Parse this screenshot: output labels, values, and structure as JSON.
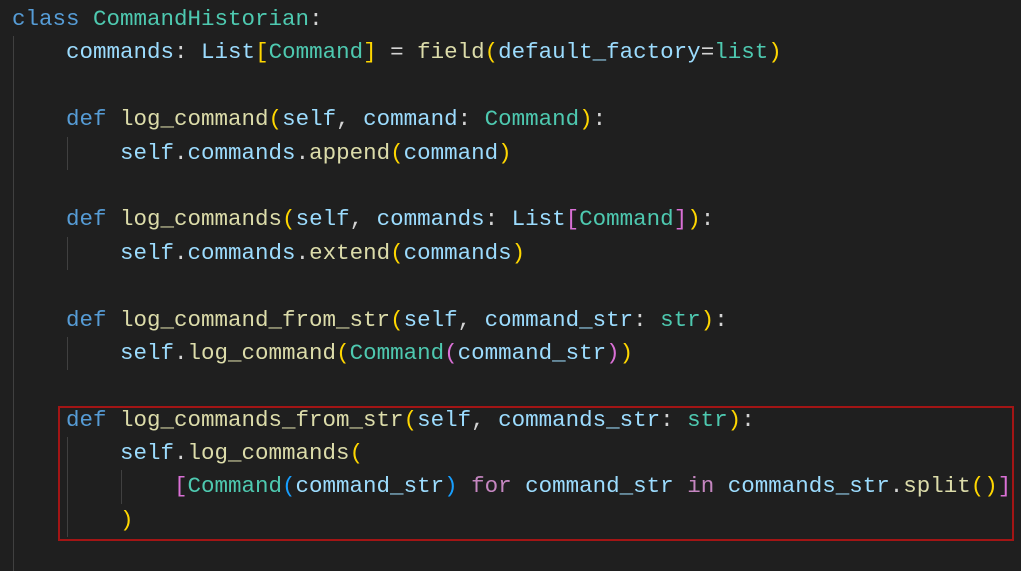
{
  "lines": [
    {
      "indent": 0,
      "tokens": [
        {
          "t": "class ",
          "c": "kw"
        },
        {
          "t": "CommandHistorian",
          "c": "cls"
        },
        {
          "t": ":",
          "c": "op"
        }
      ]
    },
    {
      "indent": 4,
      "tokens": [
        {
          "t": "commands",
          "c": "var"
        },
        {
          "t": ": ",
          "c": "op"
        },
        {
          "t": "List",
          "c": "var"
        },
        {
          "t": "[",
          "c": "b1"
        },
        {
          "t": "Command",
          "c": "cls"
        },
        {
          "t": "]",
          "c": "b1"
        },
        {
          "t": " = ",
          "c": "op"
        },
        {
          "t": "field",
          "c": "fn"
        },
        {
          "t": "(",
          "c": "b1"
        },
        {
          "t": "default_factory",
          "c": "var"
        },
        {
          "t": "=",
          "c": "op"
        },
        {
          "t": "list",
          "c": "cls"
        },
        {
          "t": ")",
          "c": "b1"
        }
      ]
    },
    {
      "indent": 4,
      "tokens": []
    },
    {
      "indent": 4,
      "tokens": [
        {
          "t": "def ",
          "c": "kw"
        },
        {
          "t": "log_command",
          "c": "fn"
        },
        {
          "t": "(",
          "c": "b1"
        },
        {
          "t": "self",
          "c": "var"
        },
        {
          "t": ", ",
          "c": "op"
        },
        {
          "t": "command",
          "c": "var"
        },
        {
          "t": ": ",
          "c": "op"
        },
        {
          "t": "Command",
          "c": "cls"
        },
        {
          "t": ")",
          "c": "b1"
        },
        {
          "t": ":",
          "c": "op"
        }
      ]
    },
    {
      "indent": 8,
      "tokens": [
        {
          "t": "self",
          "c": "var"
        },
        {
          "t": ".",
          "c": "op"
        },
        {
          "t": "commands",
          "c": "var"
        },
        {
          "t": ".",
          "c": "op"
        },
        {
          "t": "append",
          "c": "fn"
        },
        {
          "t": "(",
          "c": "b1"
        },
        {
          "t": "command",
          "c": "var"
        },
        {
          "t": ")",
          "c": "b1"
        }
      ]
    },
    {
      "indent": 4,
      "tokens": []
    },
    {
      "indent": 4,
      "tokens": [
        {
          "t": "def ",
          "c": "kw"
        },
        {
          "t": "log_commands",
          "c": "fn"
        },
        {
          "t": "(",
          "c": "b1"
        },
        {
          "t": "self",
          "c": "var"
        },
        {
          "t": ", ",
          "c": "op"
        },
        {
          "t": "commands",
          "c": "var"
        },
        {
          "t": ": ",
          "c": "op"
        },
        {
          "t": "List",
          "c": "var"
        },
        {
          "t": "[",
          "c": "b2"
        },
        {
          "t": "Command",
          "c": "cls"
        },
        {
          "t": "]",
          "c": "b2"
        },
        {
          "t": ")",
          "c": "b1"
        },
        {
          "t": ":",
          "c": "op"
        }
      ]
    },
    {
      "indent": 8,
      "tokens": [
        {
          "t": "self",
          "c": "var"
        },
        {
          "t": ".",
          "c": "op"
        },
        {
          "t": "commands",
          "c": "var"
        },
        {
          "t": ".",
          "c": "op"
        },
        {
          "t": "extend",
          "c": "fn"
        },
        {
          "t": "(",
          "c": "b1"
        },
        {
          "t": "commands",
          "c": "var"
        },
        {
          "t": ")",
          "c": "b1"
        }
      ]
    },
    {
      "indent": 4,
      "tokens": []
    },
    {
      "indent": 4,
      "tokens": [
        {
          "t": "def ",
          "c": "kw"
        },
        {
          "t": "log_command_from_str",
          "c": "fn"
        },
        {
          "t": "(",
          "c": "b1"
        },
        {
          "t": "self",
          "c": "var"
        },
        {
          "t": ", ",
          "c": "op"
        },
        {
          "t": "command_str",
          "c": "var"
        },
        {
          "t": ": ",
          "c": "op"
        },
        {
          "t": "str",
          "c": "cls"
        },
        {
          "t": ")",
          "c": "b1"
        },
        {
          "t": ":",
          "c": "op"
        }
      ]
    },
    {
      "indent": 8,
      "tokens": [
        {
          "t": "self",
          "c": "var"
        },
        {
          "t": ".",
          "c": "op"
        },
        {
          "t": "log_command",
          "c": "fn"
        },
        {
          "t": "(",
          "c": "b1"
        },
        {
          "t": "Command",
          "c": "cls"
        },
        {
          "t": "(",
          "c": "b2"
        },
        {
          "t": "command_str",
          "c": "var"
        },
        {
          "t": ")",
          "c": "b2"
        },
        {
          "t": ")",
          "c": "b1"
        }
      ]
    },
    {
      "indent": 4,
      "tokens": []
    },
    {
      "indent": 4,
      "tokens": [
        {
          "t": "def ",
          "c": "kw"
        },
        {
          "t": "log_commands_from_str",
          "c": "fn"
        },
        {
          "t": "(",
          "c": "b1"
        },
        {
          "t": "self",
          "c": "var"
        },
        {
          "t": ", ",
          "c": "op"
        },
        {
          "t": "commands_str",
          "c": "var"
        },
        {
          "t": ": ",
          "c": "op"
        },
        {
          "t": "str",
          "c": "cls"
        },
        {
          "t": ")",
          "c": "b1"
        },
        {
          "t": ":",
          "c": "op"
        }
      ]
    },
    {
      "indent": 8,
      "tokens": [
        {
          "t": "self",
          "c": "var"
        },
        {
          "t": ".",
          "c": "op"
        },
        {
          "t": "log_commands",
          "c": "fn"
        },
        {
          "t": "(",
          "c": "b1"
        }
      ]
    },
    {
      "indent": 12,
      "tokens": [
        {
          "t": "[",
          "c": "b2"
        },
        {
          "t": "Command",
          "c": "cls"
        },
        {
          "t": "(",
          "c": "b3"
        },
        {
          "t": "command_str",
          "c": "var"
        },
        {
          "t": ")",
          "c": "b3"
        },
        {
          "t": " ",
          "c": "op"
        },
        {
          "t": "for",
          "c": "ctl"
        },
        {
          "t": " ",
          "c": "op"
        },
        {
          "t": "command_str",
          "c": "var"
        },
        {
          "t": " ",
          "c": "op"
        },
        {
          "t": "in",
          "c": "ctl"
        },
        {
          "t": " ",
          "c": "op"
        },
        {
          "t": "commands_str",
          "c": "var"
        },
        {
          "t": ".",
          "c": "op"
        },
        {
          "t": "split",
          "c": "fn"
        },
        {
          "t": "()",
          "c": "b1"
        },
        {
          "t": "]",
          "c": "b2"
        }
      ]
    },
    {
      "indent": 8,
      "tokens": [
        {
          "t": ")",
          "c": "b1"
        }
      ]
    },
    {
      "indent": 4,
      "tokens": []
    }
  ]
}
